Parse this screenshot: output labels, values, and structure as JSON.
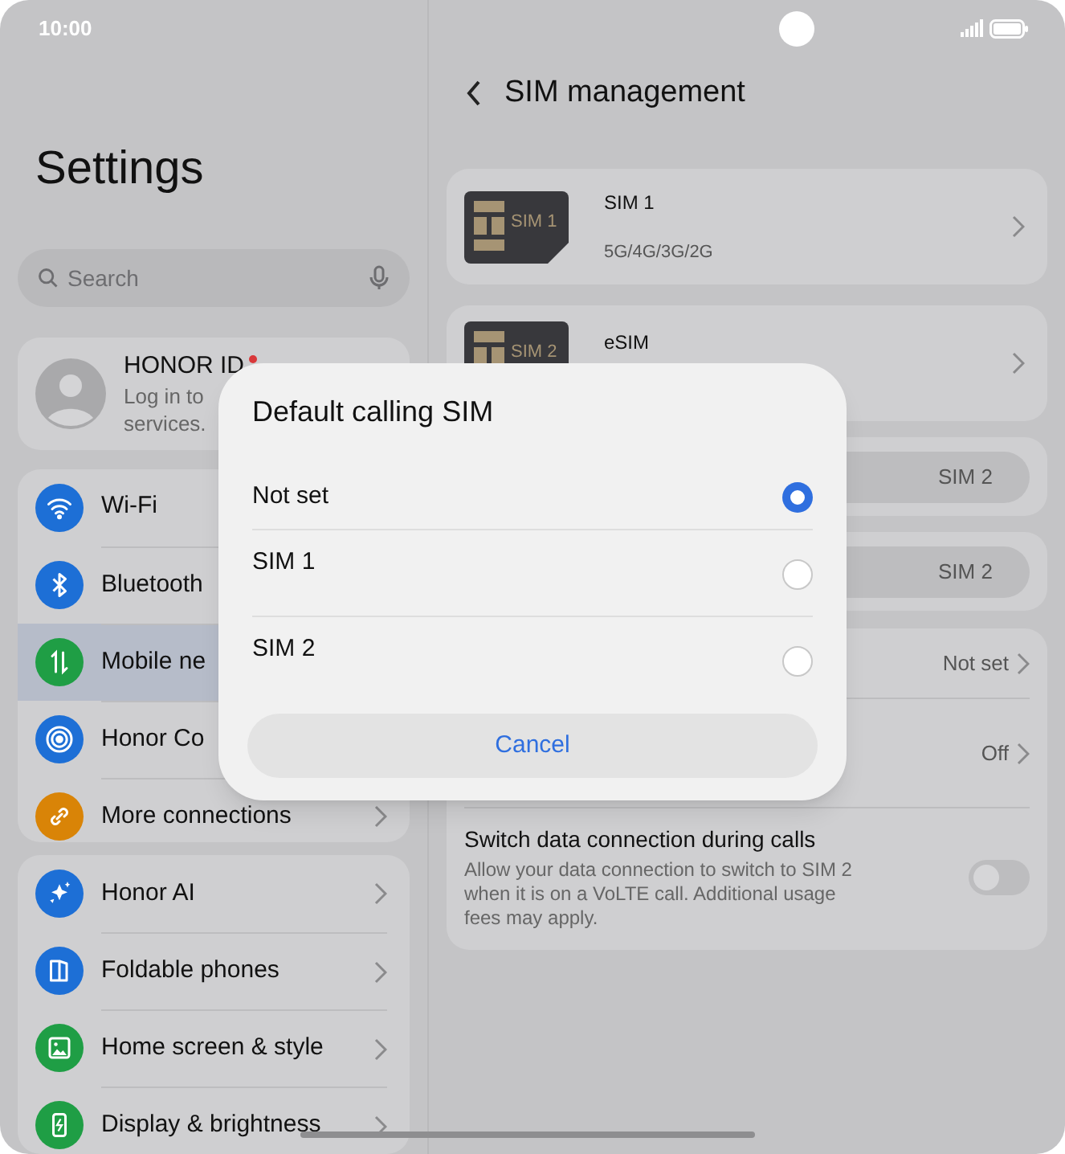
{
  "status_bar": {
    "time": "10:00"
  },
  "settings": {
    "title": "Settings",
    "search": {
      "placeholder": "Search"
    },
    "account": {
      "name": "HONOR ID",
      "notification_dot": true,
      "subtitle_lines": [
        "Log in to",
        "services."
      ]
    },
    "groups": [
      {
        "items": [
          {
            "label": "Wi-Fi",
            "kind": "wifi",
            "color": "#1d6fd6",
            "selected": false,
            "chevron": false
          },
          {
            "label": "Bluetooth",
            "kind": "bluetooth",
            "color": "#1d6fd6",
            "selected": false,
            "chevron": false
          },
          {
            "label": "Mobile ne",
            "kind": "mobile-data",
            "color": "#1f9e45",
            "selected": true,
            "chevron": false
          },
          {
            "label": "Honor Co",
            "kind": "connect",
            "color": "#1d6fd6",
            "selected": false,
            "chevron": false
          },
          {
            "label": "More connections",
            "kind": "link",
            "color": "#d98407",
            "selected": false,
            "chevron": true
          }
        ]
      },
      {
        "items": [
          {
            "label": "Honor AI",
            "kind": "sparkle",
            "color": "#1d6fd6",
            "selected": false,
            "chevron": true
          },
          {
            "label": "Foldable phones",
            "kind": "fold",
            "color": "#1d6fd6",
            "selected": false,
            "chevron": true
          },
          {
            "label": "Home screen & style",
            "kind": "image",
            "color": "#1f9e45",
            "selected": false,
            "chevron": true
          },
          {
            "label": "Display & brightness",
            "kind": "display",
            "color": "#1f9e45",
            "selected": false,
            "chevron": true
          }
        ]
      }
    ]
  },
  "sim_management": {
    "title": "SIM management",
    "sims": [
      {
        "card_label": "SIM 1",
        "name": "SIM 1",
        "detail": "5G/4G/3G/2G"
      },
      {
        "card_label": "SIM 2",
        "name": "eSIM"
      }
    ],
    "segmented": [
      {
        "option": "SIM 2"
      },
      {
        "option": "SIM 2"
      }
    ],
    "rows": [
      {
        "value": "Not set"
      },
      {
        "value": "Off"
      }
    ],
    "switch_row": {
      "title": "Switch data connection during calls",
      "description": "Allow your data connection to switch to SIM 2 when it is on a VoLTE call. Additional usage fees may apply.",
      "on": false
    }
  },
  "dialog": {
    "title": "Default calling SIM",
    "options": [
      {
        "label": "Not set",
        "selected": true
      },
      {
        "label": "SIM 1",
        "selected": false
      },
      {
        "label": "SIM 2",
        "selected": false
      }
    ],
    "cancel": "Cancel"
  }
}
